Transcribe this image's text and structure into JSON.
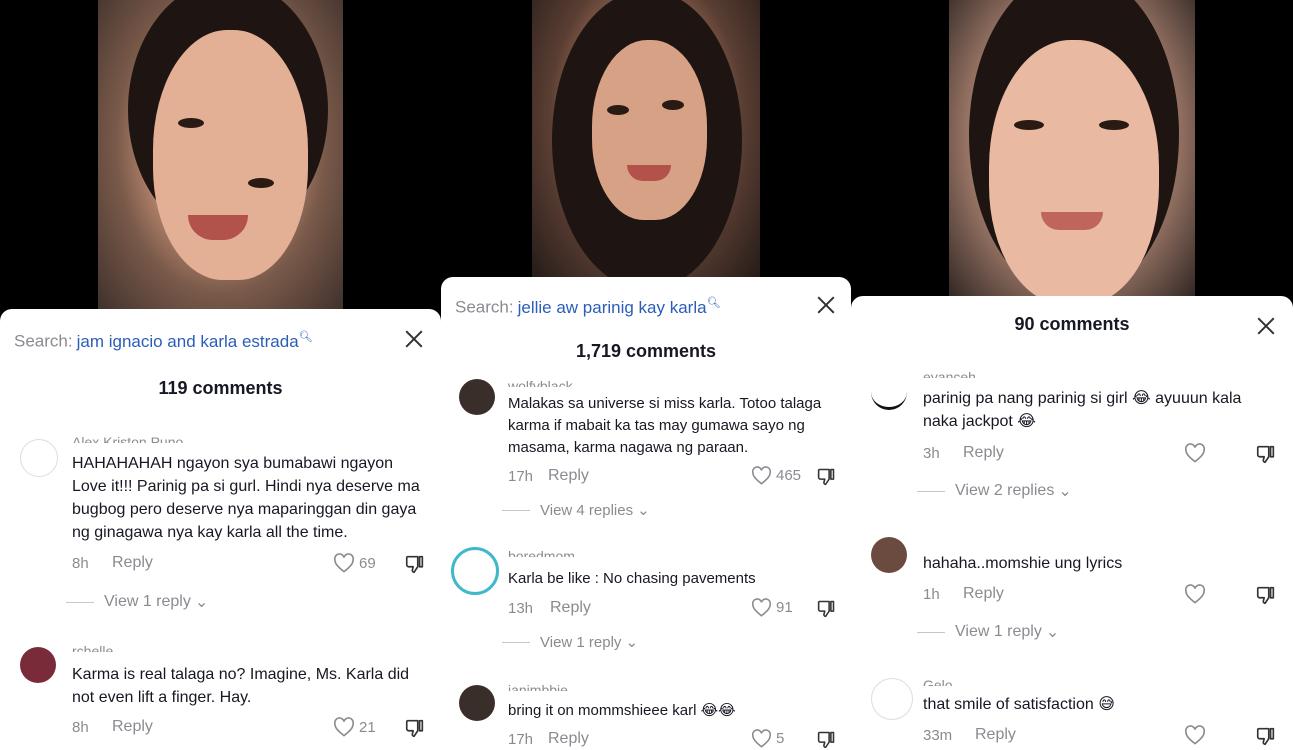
{
  "panels": [
    {
      "search_label": "Search:",
      "search_term": "jam ignacio and karla estrada",
      "comment_count": "119 comments",
      "comments": [
        {
          "name": "Alex Kriston Puno",
          "text": "HAHAHAHAH ngayon sya bumabawi ngayon Love it!!! Parinig pa si gurl. Hindi nya deserve ma bugbog pero deserve nya maparinggan din gaya ng ginagawa nya kay karla all the time.",
          "time": "8h",
          "reply": "Reply",
          "likes": "69",
          "view_replies": "View 1 reply"
        },
        {
          "name": "rchelle",
          "text": "Karma is real talaga no? Imagine, Ms. Karla did not even lift a finger. Hay.",
          "time": "8h",
          "reply": "Reply",
          "likes": "21"
        }
      ]
    },
    {
      "search_label": "Search:",
      "search_term": "jellie aw parinig kay karla",
      "comment_count": "1,719 comments",
      "comments": [
        {
          "name": "wolfyblack",
          "text": "Malakas sa universe si miss karla. Totoo talaga karma if mabait ka tas may gumawa sayo ng masama, karma nagawa ng paraan.",
          "time": "17h",
          "reply": "Reply",
          "likes": "465",
          "view_replies": "View 4 replies"
        },
        {
          "name": "boredmom",
          "text": "Karla be like : No chasing pavements",
          "time": "13h",
          "reply": "Reply",
          "likes": "91",
          "view_replies": "View 1 reply"
        },
        {
          "name": "janimbbie",
          "text": "bring it on mommshieee karl 😂😂",
          "time": "17h",
          "reply": "Reply",
          "likes": "5"
        }
      ]
    },
    {
      "comment_count": "90 comments",
      "comments": [
        {
          "name": "eyanceh",
          "text": "parinig pa nang parinig si girl 😂 ayuuun kala naka jackpot 😂",
          "time": "3h",
          "reply": "Reply",
          "view_replies": "View 2 replies"
        },
        {
          "name": ".....",
          "text": "hahaha..momshie ung lyrics",
          "time": "1h",
          "reply": "Reply",
          "view_replies": "View 1 reply"
        },
        {
          "name": "Gelo",
          "text": "that smile of satisfaction 😅",
          "time": "33m",
          "reply": "Reply"
        }
      ]
    }
  ],
  "icons": [
    "close-icon",
    "heart-icon",
    "dislike-icon",
    "chevron-down-icon",
    "search-icon"
  ]
}
